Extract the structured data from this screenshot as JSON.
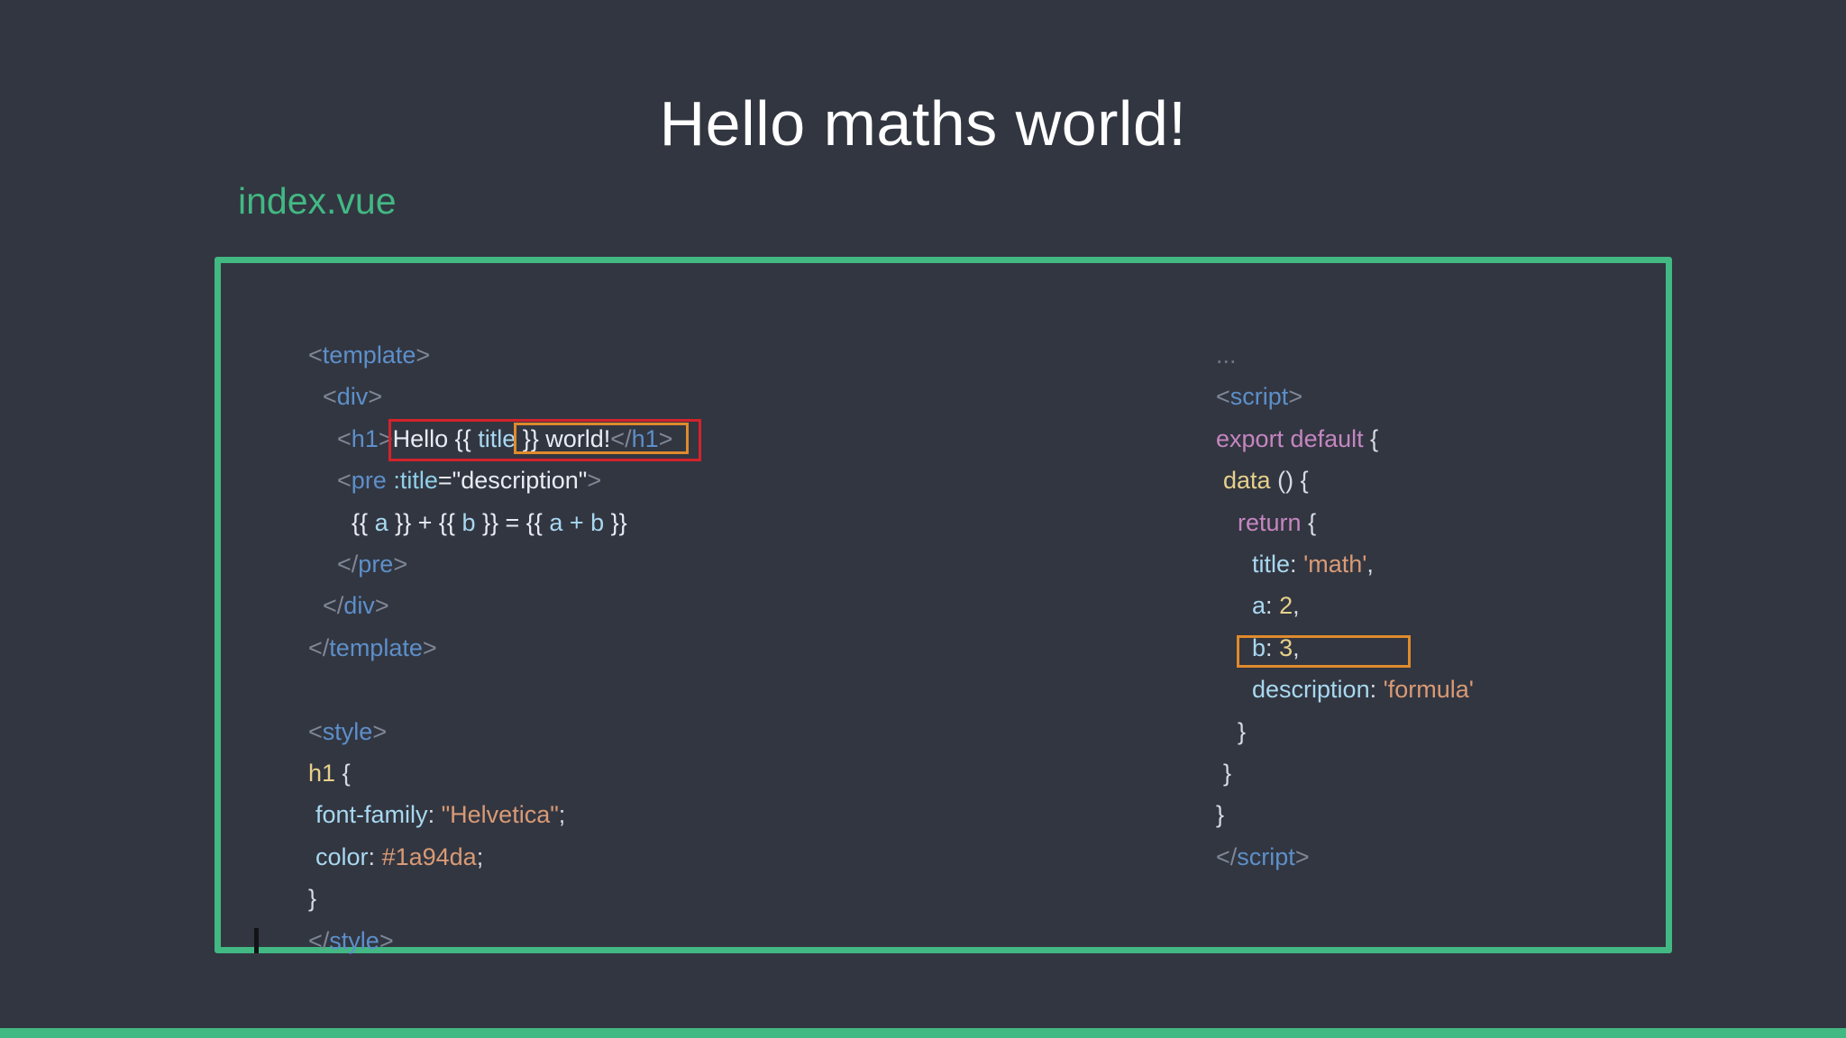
{
  "slide": {
    "title": "Hello maths world!",
    "filename": "index.vue"
  },
  "colors": {
    "background": "#323641",
    "accent": "#42b883",
    "highlight_red": "#d3232b",
    "highlight_orange": "#e08a2c"
  },
  "code_left": {
    "l1": {
      "open": "<",
      "tag": "template",
      "close": ">"
    },
    "l2": {
      "open": "<",
      "tag": "div",
      "close": ">"
    },
    "l3": {
      "open": "<",
      "tag": "h1",
      "close": ">",
      "text_a": "Hello {{ ",
      "var": "title",
      "text_b": " }} world!",
      "end_open": "</",
      "end_tag": "h1",
      "end_close": ">"
    },
    "l4": {
      "open": "<",
      "tag": "pre",
      "attr": " :title",
      "eq": "=",
      "value": "\"description\"",
      "close": ">"
    },
    "l5": {
      "a1": "{{ ",
      "a": "a",
      "a2": " }} + {{ ",
      "b": "b",
      "b2": " }} = {{ ",
      "ab": "a + b",
      "ab2": " }}"
    },
    "l6": {
      "open": "</",
      "tag": "pre",
      "close": ">"
    },
    "l7": {
      "open": "</",
      "tag": "div",
      "close": ">"
    },
    "l8": {
      "open": "</",
      "tag": "template",
      "close": ">"
    },
    "l10": {
      "open": "<",
      "tag": "style",
      "close": ">"
    },
    "l11": {
      "selector": "h1",
      "brace": " {"
    },
    "l12": {
      "prop": "font-family",
      "colon": ": ",
      "value": "\"Helvetica\"",
      "semi": ";"
    },
    "l13": {
      "prop": "color",
      "colon": ": ",
      "value": "#1a94da",
      "semi": ";"
    },
    "l14": {
      "brace": "}"
    },
    "l15": {
      "open": "</",
      "tag": "style",
      "close": ">"
    }
  },
  "code_right": {
    "r1": {
      "ellipsis": "..."
    },
    "r2": {
      "open": "<",
      "tag": "script",
      "close": ">"
    },
    "r3": {
      "kw": "export default",
      "brace": " {"
    },
    "r4": {
      "fn": "data",
      "rest": " () {"
    },
    "r5": {
      "kw": "return",
      "brace": " {"
    },
    "r6": {
      "key": "title",
      "colon": ": ",
      "value": "'math'",
      "comma": ","
    },
    "r7": {
      "key": "a",
      "colon": ": ",
      "value": "2",
      "comma": ","
    },
    "r8": {
      "key": "b",
      "colon": ": ",
      "value": "3",
      "comma": ","
    },
    "r9": {
      "key": "description",
      "colon": ": ",
      "value": "'formula'"
    },
    "r10": {
      "brace": "}"
    },
    "r11": {
      "brace": "}"
    },
    "r12": {
      "brace": "}"
    },
    "r13": {
      "open": "</",
      "tag": "script",
      "close": ">"
    }
  }
}
